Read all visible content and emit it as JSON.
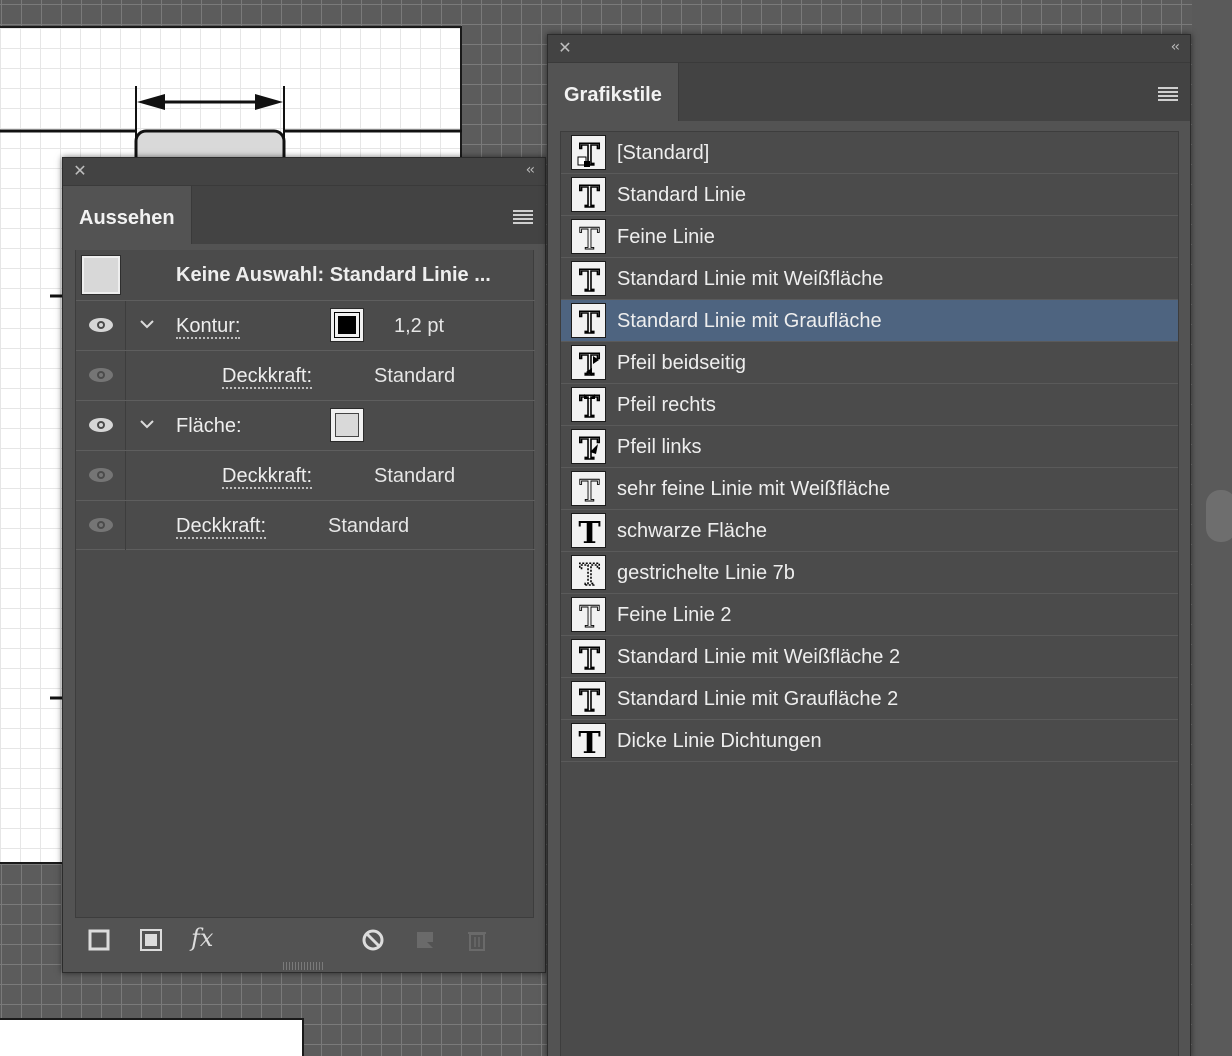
{
  "aussehen_panel": {
    "tab_label": "Aussehen",
    "header_title": "Keine Auswahl: Standard Linie ...",
    "rows": [
      {
        "label": "Kontur:",
        "value": "1,2 pt"
      },
      {
        "label": "Deckkraft:",
        "value": "Standard"
      },
      {
        "label": "Fläche:",
        "value": ""
      },
      {
        "label": "Deckkraft:",
        "value": "Standard"
      },
      {
        "label": "Deckkraft:",
        "value": "Standard"
      }
    ],
    "footer_fx": "fx"
  },
  "grafikstile_panel": {
    "tab_label": "Grafikstile",
    "selected_index": 4,
    "styles": [
      {
        "name": "[Standard]"
      },
      {
        "name": "Standard Linie"
      },
      {
        "name": "Feine Linie"
      },
      {
        "name": "Standard Linie mit Weißfläche"
      },
      {
        "name": "Standard Linie mit Graufläche"
      },
      {
        "name": "Pfeil beidseitig"
      },
      {
        "name": "Pfeil rechts"
      },
      {
        "name": "Pfeil links"
      },
      {
        "name": "sehr feine Linie mit Weißfläche"
      },
      {
        "name": "schwarze Fläche"
      },
      {
        "name": "gestrichelte Linie 7b"
      },
      {
        "name": "Feine Linie 2"
      },
      {
        "name": "Standard Linie mit Weißfläche 2"
      },
      {
        "name": "Standard Linie mit Graufläche 2"
      },
      {
        "name": "Dicke Linie Dichtungen"
      }
    ]
  },
  "colors": {
    "panel_bg": "#535353",
    "selection": "#4e6480",
    "canvas_bg": "#5c5c5c"
  },
  "icons": {
    "close": "close-icon",
    "collapse": "double-chevron-left-icon",
    "panel_menu": "hamburger-menu-icon",
    "visibility": "eye-icon",
    "expand": "chevron-down-icon",
    "add_stroke": "new-stroke-icon",
    "add_fill": "new-fill-icon",
    "effects": "fx-icon",
    "clear": "clear-appearance-icon",
    "duplicate": "duplicate-item-icon",
    "delete": "trash-icon",
    "style_thumb": "graphic-style-thumbnail-icon"
  }
}
